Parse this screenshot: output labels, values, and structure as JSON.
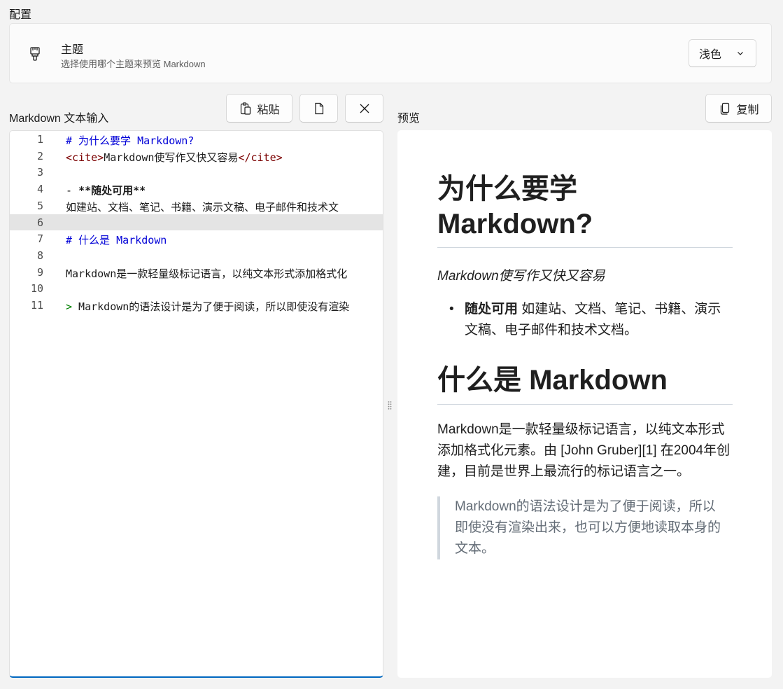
{
  "config": {
    "section_title": "配置",
    "theme_setting": {
      "title": "主题",
      "description": "选择使用哪个主题来预览 Markdown",
      "selected": "浅色",
      "icon": "paintbrush-icon"
    }
  },
  "input_pane": {
    "label": "Markdown 文本输入",
    "paste_label": "粘贴",
    "paste_icon": "paste-icon",
    "open_icon": "document-icon",
    "clear_icon": "close-icon",
    "current_line": 6,
    "lines": [
      {
        "no": "1",
        "text": "# 为什么要学 Markdown?"
      },
      {
        "no": "2",
        "open_tag": "<cite>",
        "text": "Markdown使写作又快又容易",
        "close_tag": "</cite>"
      },
      {
        "no": "3",
        "text": ""
      },
      {
        "no": "4",
        "prefix": "- ",
        "text": "**随处可用**"
      },
      {
        "no": "5",
        "text": "如建站、文档、笔记、书籍、演示文稿、电子邮件和技术文"
      },
      {
        "no": "6",
        "text": ""
      },
      {
        "no": "7",
        "text": "# 什么是 Markdown"
      },
      {
        "no": "8",
        "text": ""
      },
      {
        "no": "9",
        "text": "Markdown是一款轻量级标记语言，以纯文本形式添加格式化"
      },
      {
        "no": "10",
        "text": ""
      },
      {
        "no": "11",
        "marker": ">",
        "text": " Markdown的语法设计是为了便于阅读，所以即使没有渲染"
      }
    ]
  },
  "preview_pane": {
    "label": "预览",
    "copy_label": "复制",
    "copy_icon": "copy-icon",
    "h1_line1": "为什么要学",
    "h1_line2": "Markdown?",
    "cite": "Markdown使写作又快又容易",
    "list_item_strong": "随处可用",
    "list_item_text": " 如建站、文档、笔记、书籍、演示文稿、电子邮件和技术文档。",
    "h2": "什么是 Markdown",
    "paragraph": "Markdown是一款轻量级标记语言，以纯文本形式添加格式化元素。由 [John Gruber][1] 在2004年创建，目前是世界上最流行的标记语言之一。",
    "blockquote": "Markdown的语法设计是为了便于阅读，所以即使没有渲染出来，也可以方便地读取本身的文本。"
  }
}
